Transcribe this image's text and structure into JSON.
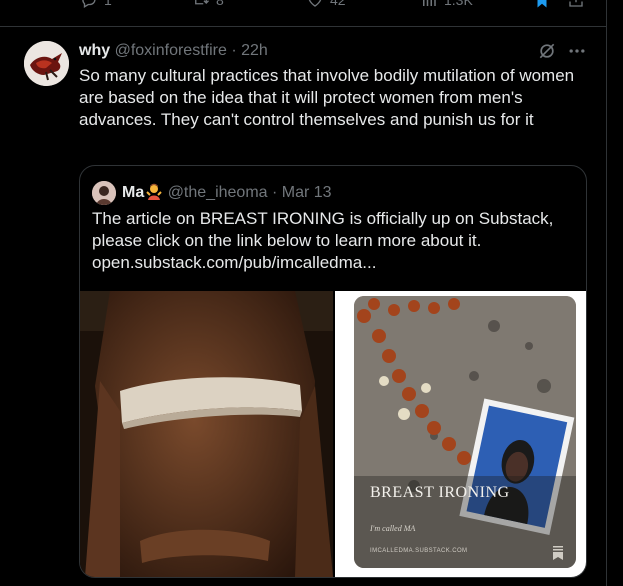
{
  "previous_post_actions": {
    "replies": "1",
    "reposts": "8",
    "likes": "42",
    "views": "1.3K"
  },
  "post": {
    "display_name": "why",
    "handle": "@foxinforestfire",
    "separator": "·",
    "time": "22h",
    "text": "So many cultural practices that involve bodily mutilation of women are based on the idea that it will protect women from men's advances. They can't control themselves and punish us for it"
  },
  "quoted_post": {
    "display_name": "Ma",
    "emoji_icon": "person-gesturing-emoji",
    "handle": "@the_iheoma",
    "separator": "·",
    "time": "Mar 13",
    "text_line1": "The article on BREAST IRONING is officially up on Substack,",
    "text_line2": "please click on the link below to learn more about it.",
    "link": "open.substack.com/pub/imcalledma...",
    "cover": {
      "title": "BREAST IRONING",
      "subtitle": "I'm called MA",
      "url": "IMCALLEDMA.SUBSTACK.COM"
    }
  },
  "colors": {
    "background": "#000000",
    "text": "#e7e9ea",
    "muted": "#71767b",
    "border": "#2f3336",
    "bookmark_active": "#1d9bf0"
  }
}
